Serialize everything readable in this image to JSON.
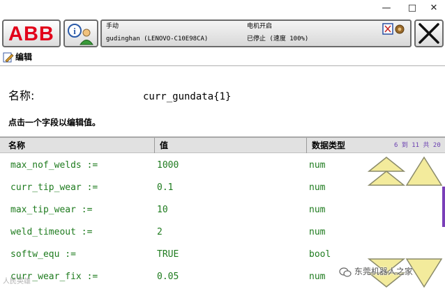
{
  "window": {
    "minimize": "—",
    "maximize": "□",
    "close": "✕",
    "menu": "⋮"
  },
  "header": {
    "logo": "ABB",
    "status": {
      "mode": "手动",
      "controller": "gudinghan (LENOVO-C10E98CA)",
      "motor_state": "电机开启",
      "program_state": "已停止 (速度 100%)"
    }
  },
  "app": {
    "tab_label": "编辑"
  },
  "editor": {
    "name_label": "名称:",
    "name_value": "curr_gundata{1}",
    "instruction": "点击一个字段以编辑值。"
  },
  "table": {
    "columns": [
      "名称",
      "值",
      "数据类型"
    ],
    "page_indicator": "6 到 11 共 20",
    "rows": [
      {
        "name": "max_nof_welds :=",
        "value": "1000",
        "type": "num"
      },
      {
        "name": "curr_tip_wear :=",
        "value": "0.1",
        "type": "num"
      },
      {
        "name": "max_tip_wear :=",
        "value": "10",
        "type": "num"
      },
      {
        "name": "weld_timeout :=",
        "value": "2",
        "type": "num"
      },
      {
        "name": "softw_equ :=",
        "value": "TRUE",
        "type": "bool"
      },
      {
        "name": "curr_wear_fix :=",
        "value": "0.05",
        "type": "num"
      }
    ]
  },
  "colors": {
    "abb_red": "#e2001a",
    "value_green": "#1e7b1e",
    "scroll_yellow": "#f3eb9c",
    "page_indicator": "#6a3fb0"
  },
  "watermark": {
    "text": "东莞机器人之家",
    "left_text": "人民英雄"
  }
}
